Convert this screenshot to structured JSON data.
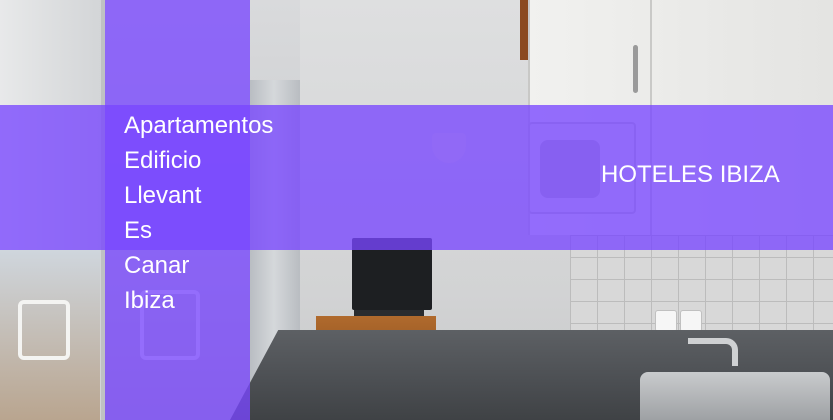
{
  "title": {
    "lines": [
      "Apartamentos",
      "Edificio",
      "Llevant",
      "Es",
      "Canar",
      "Ibiza"
    ]
  },
  "brand": "HOTELES IBIZA",
  "colors": {
    "overlay": "#7846ff",
    "text": "#ffffff"
  }
}
